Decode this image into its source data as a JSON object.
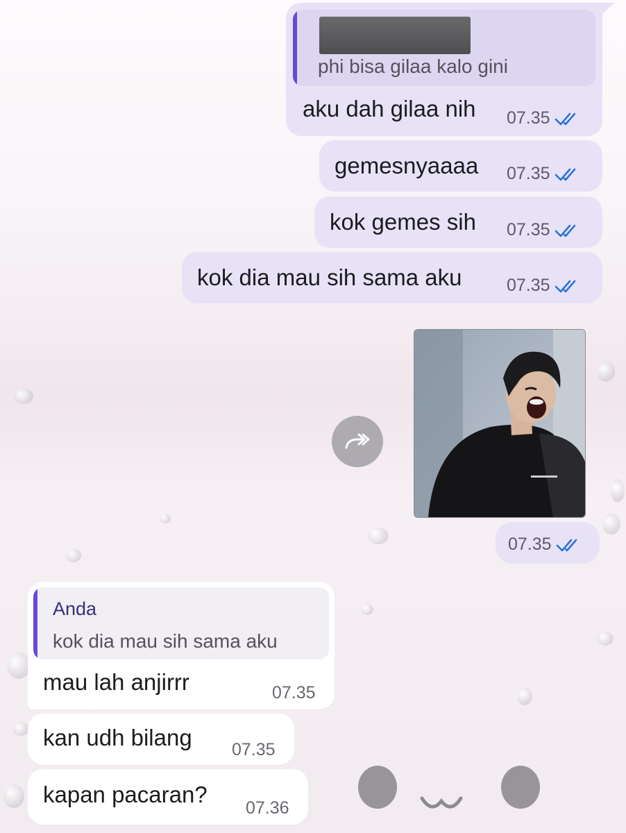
{
  "chat": {
    "outgoing": [
      {
        "quote": {
          "author_redacted": true,
          "text": "phi bisa gilaa kalo gini"
        },
        "text": "aku dah gilaa nih",
        "time": "07.35",
        "status": "read"
      },
      {
        "text": "gemesnyaaaa",
        "time": "07.35",
        "status": "read"
      },
      {
        "text": "kok gemes sih",
        "time": "07.35",
        "status": "read"
      },
      {
        "text": "kok dia mau sih sama aku",
        "time": "07.35",
        "status": "read"
      }
    ],
    "photo_message": {
      "description_icon": "photo-of-person-screaming",
      "time": "07.35",
      "status": "read",
      "share_icon": "forward-share-icon"
    },
    "incoming": [
      {
        "quote": {
          "author": "Anda",
          "text": "kok dia mau sih sama aku"
        },
        "text": "mau lah anjirrr",
        "time": "07.35"
      },
      {
        "text": "kan udh bilang",
        "time": "07.35"
      },
      {
        "text": "kapan pacaran?",
        "time": "07.36"
      }
    ]
  },
  "colors": {
    "outgoing_bubble": "#e8e2f7",
    "incoming_bubble": "#ffffff",
    "quote_bar": "#6a49d6",
    "read_ticks": "#2b73d6"
  }
}
